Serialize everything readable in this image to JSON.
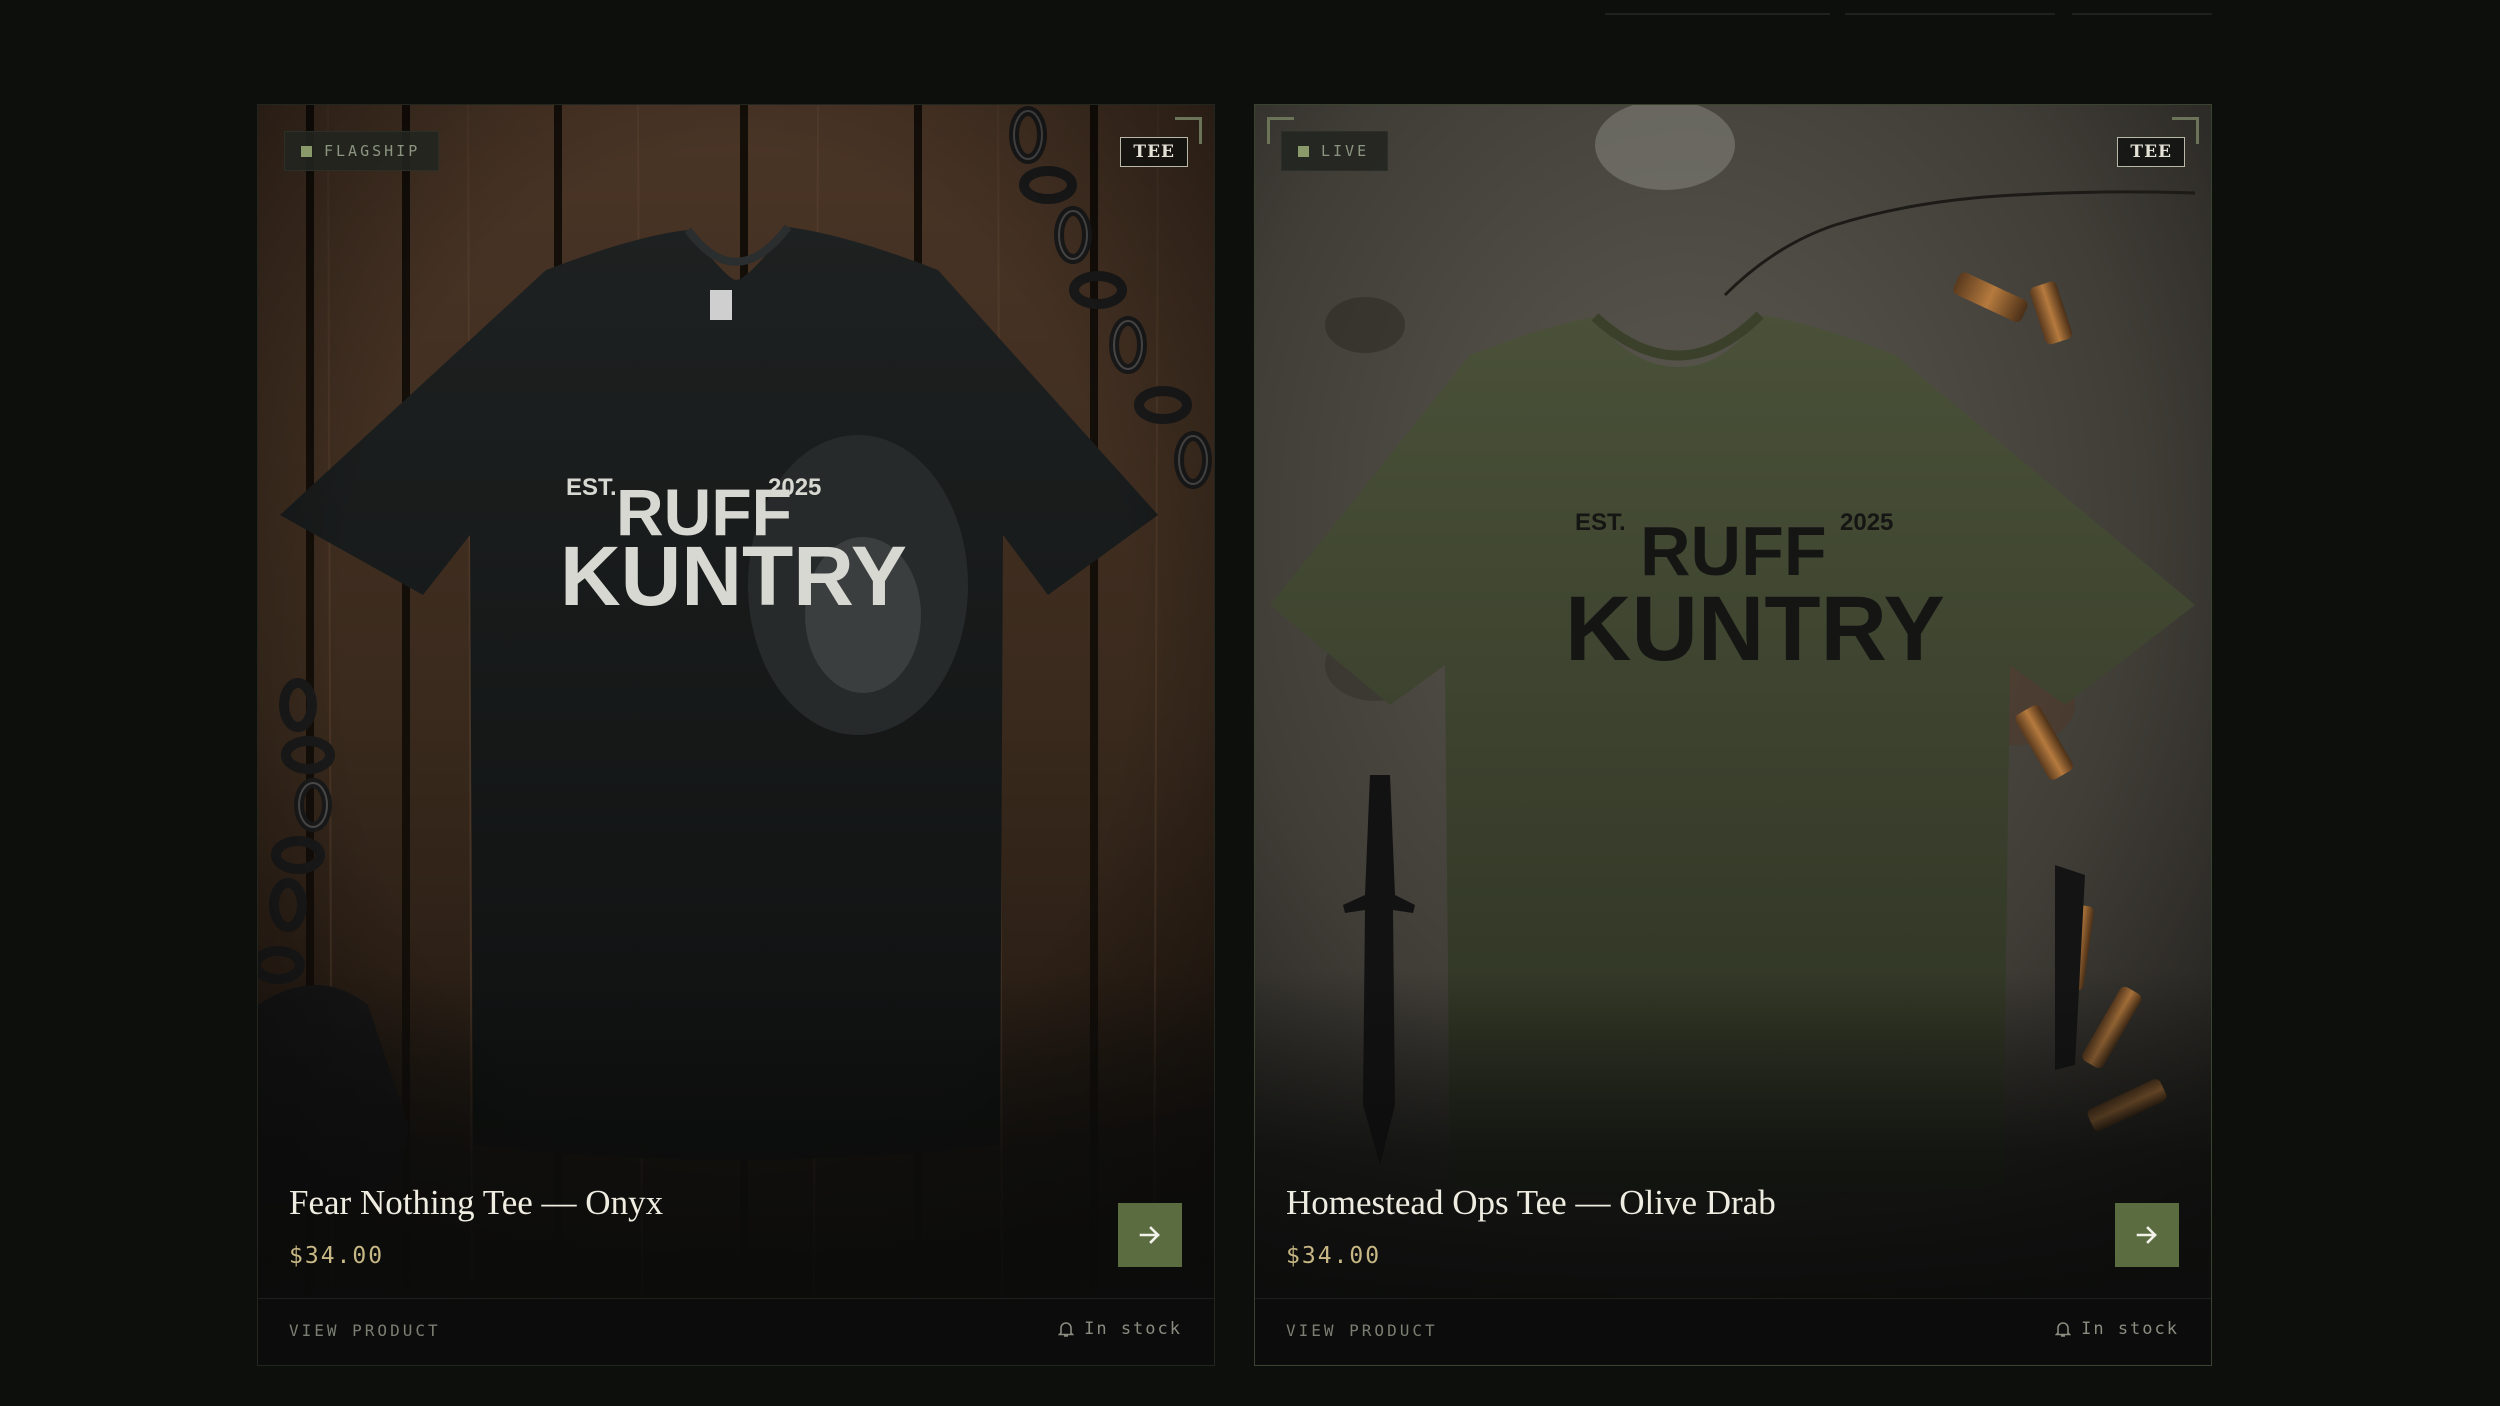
{
  "colors": {
    "page_background": "#0d0f0d",
    "accent_green": "#5b6c40",
    "price_gold": "#c7b785"
  },
  "cards": [
    {
      "badge": "FLAGSHIP",
      "type_tag": "TEE",
      "name": "Fear Nothing Tee — Onyx",
      "price": "$34.00",
      "view_label": "VIEW PRODUCT",
      "stock": "In stock",
      "shirt_print": {
        "est": "EST.",
        "year": "2025",
        "line1": "RUFF",
        "line2": "KUNTRY"
      },
      "go_icon": "arrow-right-icon",
      "stock_icon": "bell-icon"
    },
    {
      "badge": "LIVE",
      "type_tag": "TEE",
      "name": "Homestead Ops Tee — Olive Drab",
      "price": "$34.00",
      "view_label": "VIEW PRODUCT",
      "stock": "In stock",
      "shirt_print": {
        "est": "EST.",
        "year": "2025",
        "line1": "RUFF",
        "line2": "KUNTRY"
      },
      "go_icon": "arrow-right-icon",
      "stock_icon": "bell-icon"
    }
  ]
}
